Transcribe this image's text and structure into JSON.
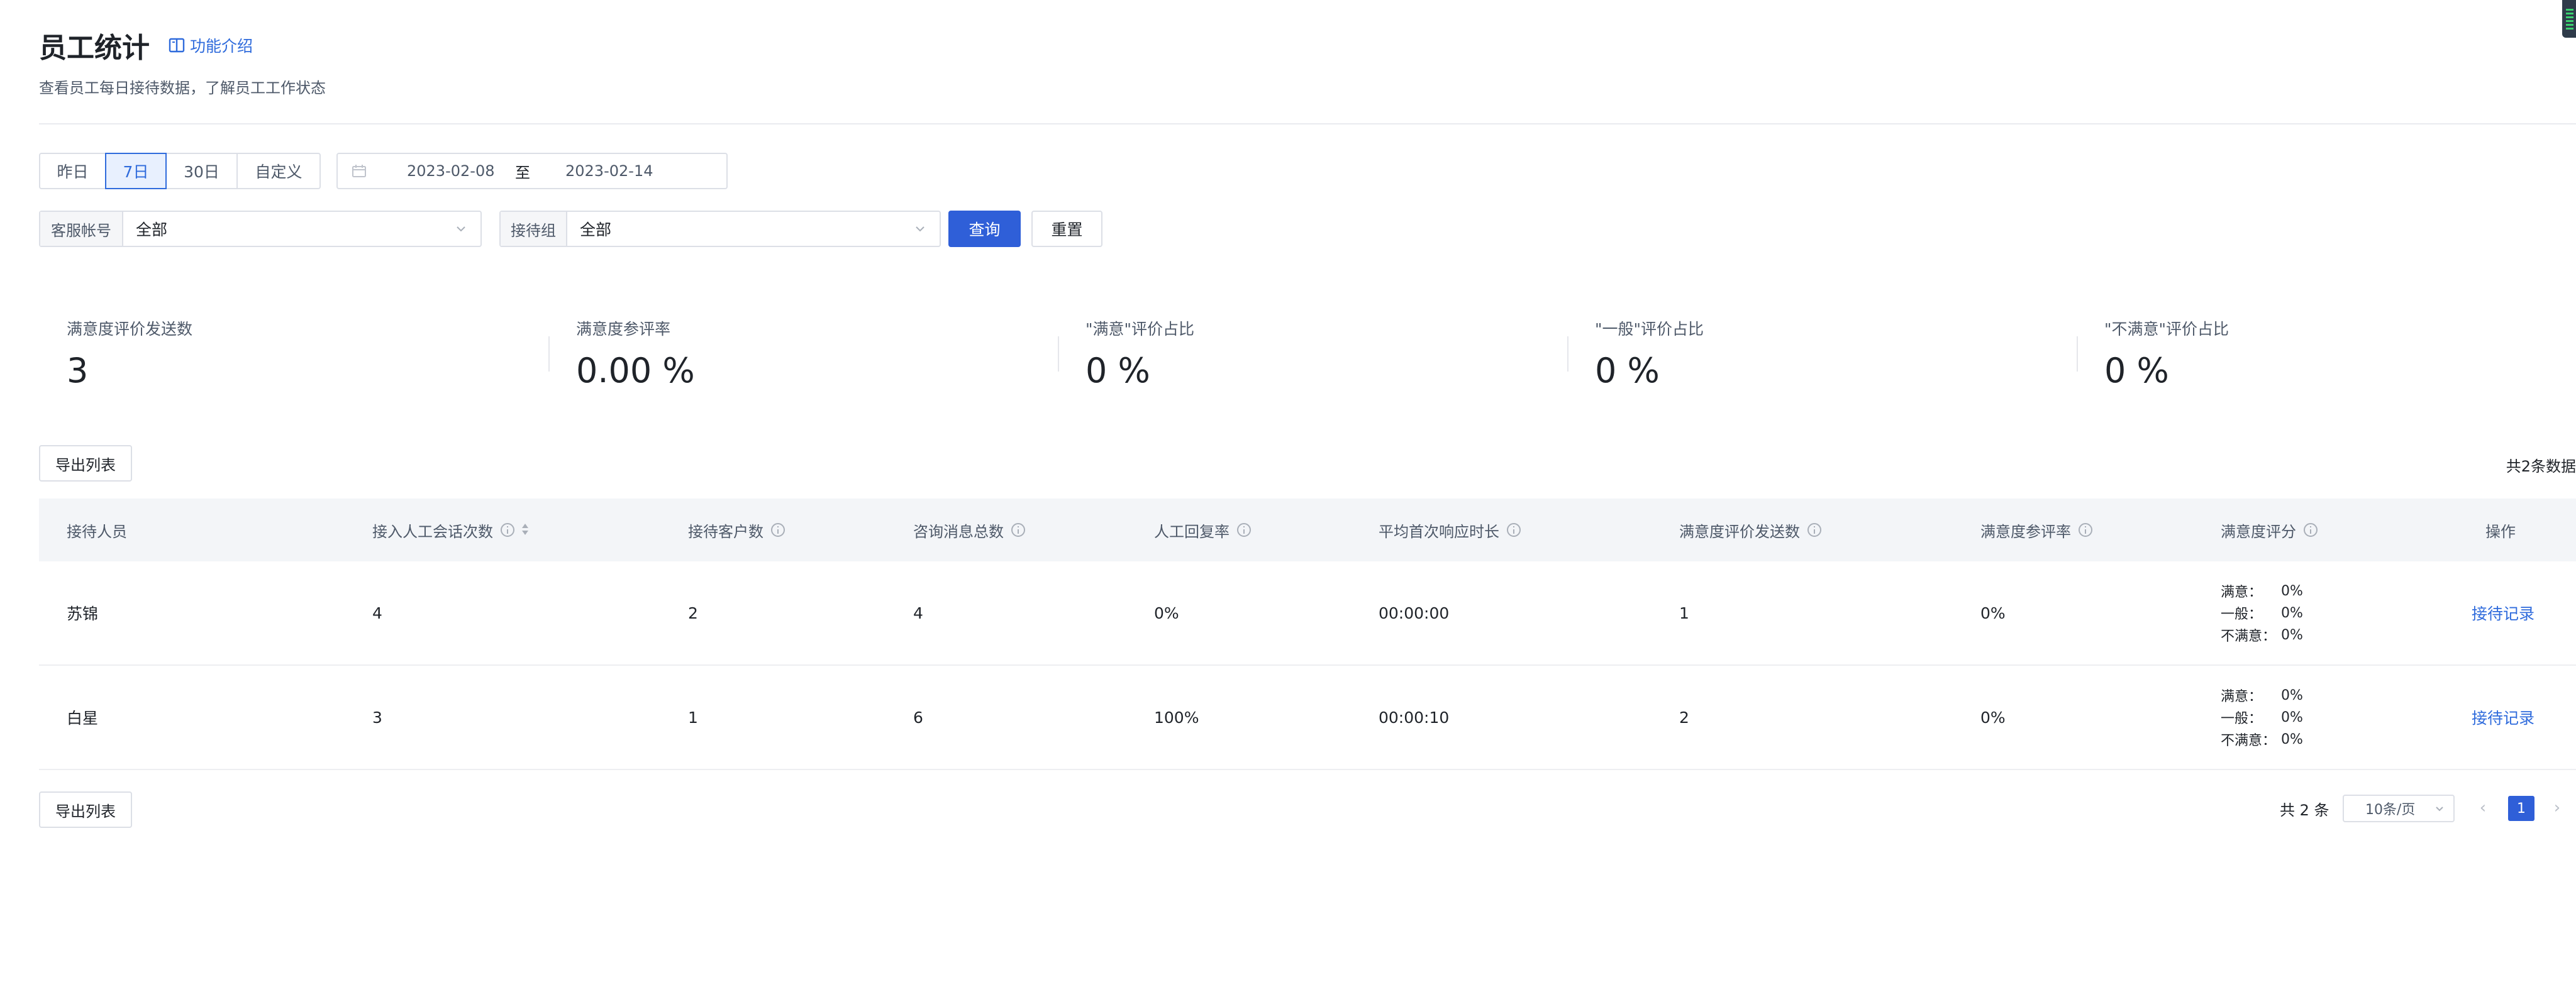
{
  "header": {
    "title": "员工统计",
    "intro_link": "功能介绍",
    "subtitle": "查看员工每日接待数据，了解员工工作状态"
  },
  "filters": {
    "quick_ranges": [
      "昨日",
      "7日",
      "30日",
      "自定义"
    ],
    "active_quick_range": "7日",
    "date_start": "2023-02-08",
    "date_separator": "至",
    "date_end": "2023-02-14",
    "account_label": "客服帐号",
    "account_value": "全部",
    "group_label": "接待组",
    "group_value": "全部",
    "query_label": "查询",
    "reset_label": "重置"
  },
  "stats": [
    {
      "label": "满意度评价发送数",
      "value": "3"
    },
    {
      "label": "满意度参评率",
      "value": "0.00 %"
    },
    {
      "label": "\"满意\"评价占比",
      "value": "0 %"
    },
    {
      "label": "\"一般\"评价占比",
      "value": "0 %"
    },
    {
      "label": "\"不满意\"评价占比",
      "value": "0 %"
    }
  ],
  "toolbar": {
    "export_label": "导出列表",
    "total_text": "共2条数据"
  },
  "table": {
    "columns": [
      "接待人员",
      "接入人工会话次数",
      "接待客户数",
      "咨询消息总数",
      "人工回复率",
      "平均首次响应时长",
      "满意度评价发送数",
      "满意度参评率",
      "满意度评分",
      "操作"
    ],
    "rows": [
      {
        "staff": "苏锦",
        "sessions": "4",
        "customers": "2",
        "messages": "4",
        "reply_rate": "0%",
        "first_response": "00:00:00",
        "survey_sent": "1",
        "participation": "0%",
        "ratings": [
          {
            "k": "满意：",
            "v": "0%"
          },
          {
            "k": "一般：",
            "v": "0%"
          },
          {
            "k": "不满意：",
            "v": "0%"
          }
        ],
        "action": "接待记录"
      },
      {
        "staff": "白星",
        "sessions": "3",
        "customers": "1",
        "messages": "6",
        "reply_rate": "100%",
        "first_response": "00:00:10",
        "survey_sent": "2",
        "participation": "0%",
        "ratings": [
          {
            "k": "满意：",
            "v": "0%"
          },
          {
            "k": "一般：",
            "v": "0%"
          },
          {
            "k": "不满意：",
            "v": "0%"
          }
        ],
        "action": "接待记录"
      }
    ]
  },
  "pagination": {
    "total_text": "共 2 条",
    "page_size": "10条/页",
    "current_page": "1",
    "prev_icon": "chevron-left-icon",
    "next_icon": "chevron-right-icon"
  },
  "colors": {
    "primary": "#2f5fd8",
    "link": "#2f6bdc",
    "header_bg": "#f3f5f8"
  }
}
